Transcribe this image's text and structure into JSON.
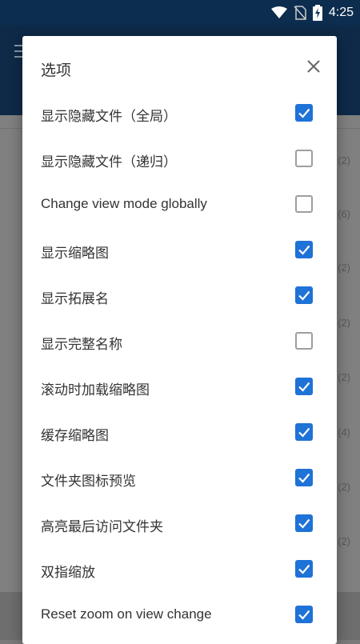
{
  "status": {
    "time": "4:25"
  },
  "background": {
    "counts": [
      "(2)",
      "(6)",
      "(2)",
      "(2)",
      "(2)",
      "(4)",
      "(2)",
      "(2)"
    ]
  },
  "dialog": {
    "title": "选项",
    "options": [
      {
        "label": "显示隐藏文件（全局）",
        "checked": true
      },
      {
        "label": "显示隐藏文件（递归）",
        "checked": false
      },
      {
        "label": "Change view mode globally",
        "checked": false
      },
      {
        "label": "显示缩略图",
        "checked": true
      },
      {
        "label": "显示拓展名",
        "checked": true
      },
      {
        "label": "显示完整名称",
        "checked": false
      },
      {
        "label": "滚动时加载缩略图",
        "checked": true
      },
      {
        "label": "缓存缩略图",
        "checked": true
      },
      {
        "label": "文件夹图标预览",
        "checked": true
      },
      {
        "label": "高亮最后访问文件夹",
        "checked": true
      },
      {
        "label": "双指缩放",
        "checked": true
      },
      {
        "label": "Reset zoom on view change",
        "checked": true
      }
    ]
  },
  "colors": {
    "accent": "#1f72d6",
    "statusbar": "#0d2d4f"
  }
}
